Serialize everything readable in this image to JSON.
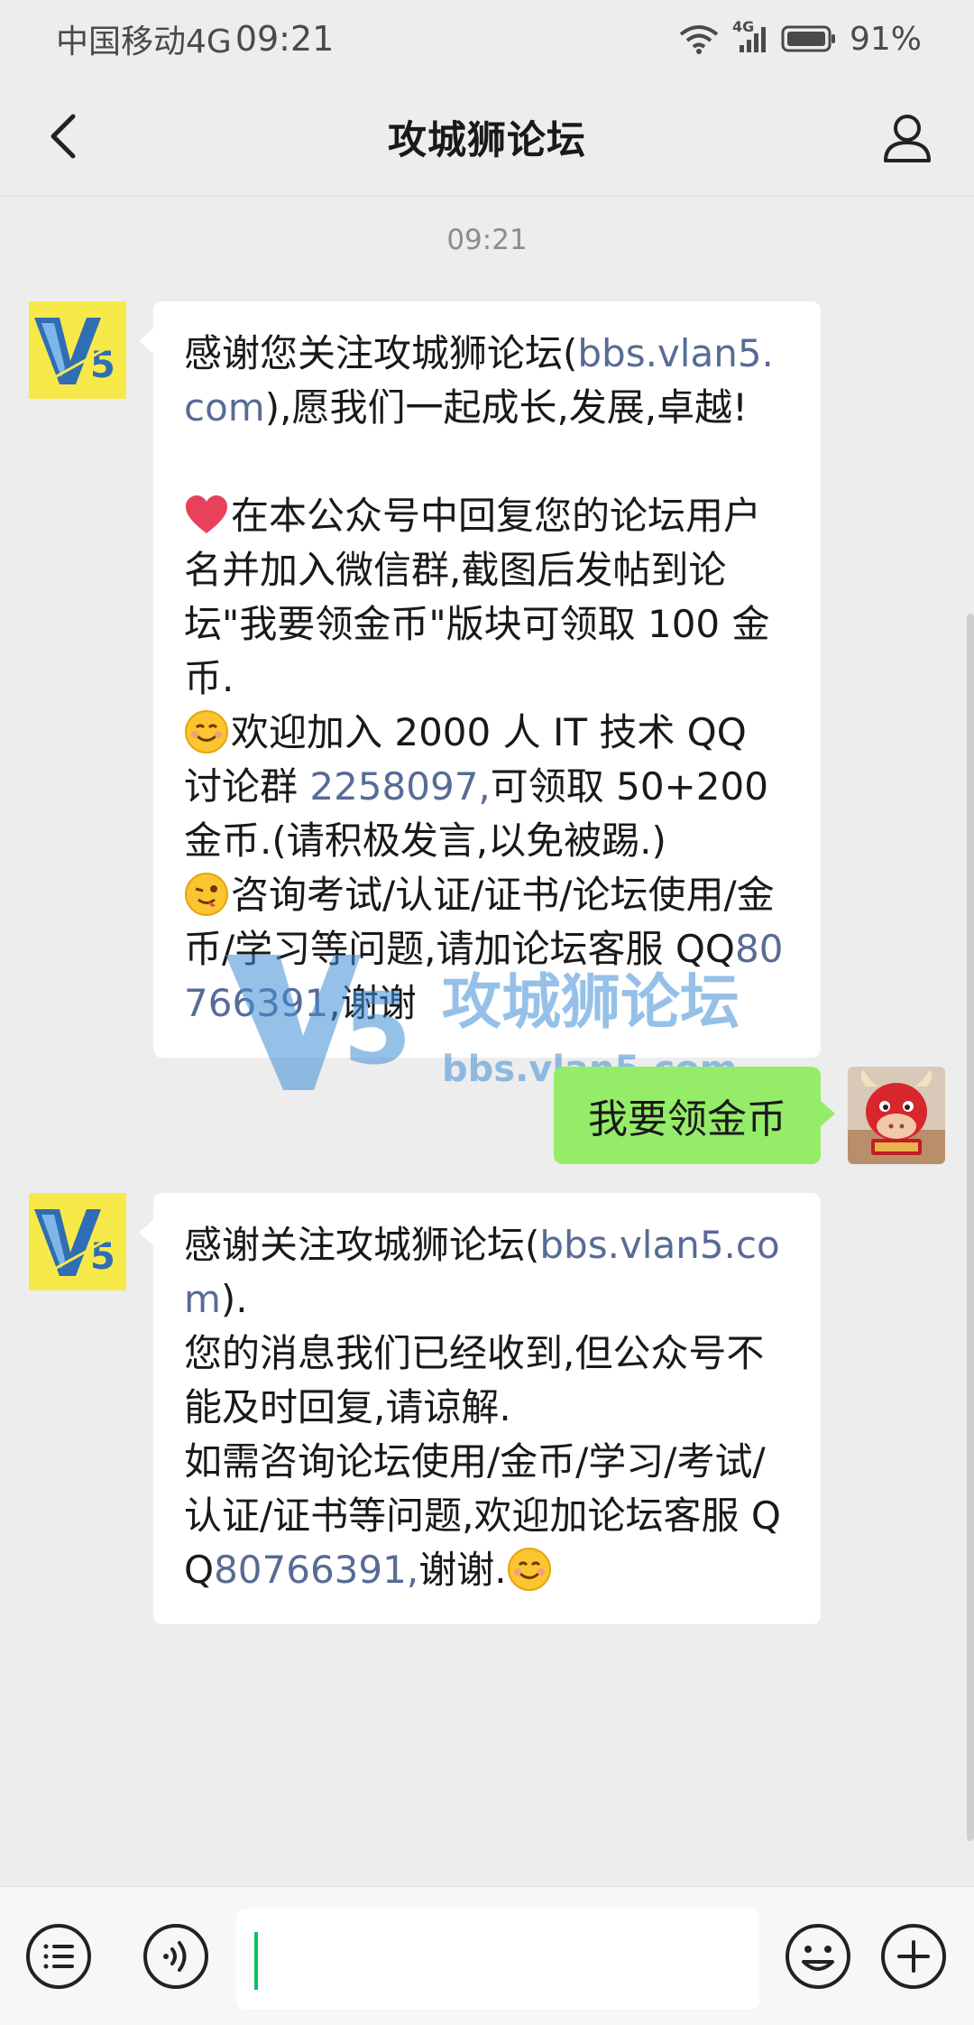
{
  "status_bar": {
    "carrier": "中国移动4G",
    "time": "09:21",
    "network_badge": "4G",
    "battery": "91%"
  },
  "header": {
    "title": "攻城狮论坛",
    "back_icon": "chevron-left-icon",
    "profile_icon": "person-icon"
  },
  "chat": {
    "timestamp": "09:21",
    "messages": [
      {
        "sender": "official-account",
        "segments": {
          "p1_a": "感谢您关注攻城狮论坛(",
          "p1_link": "bbs.vlan5.com",
          "p1_b": "),愿我们一起成长,发展,卓越!",
          "p2": "在本公众号中回复您的论坛用户名并加入微信群,截图后发帖到论坛\"我要领金币\"版块可领取 100 金币.",
          "p3_a": "欢迎加入 2000 人 IT 技术 QQ 讨论群 ",
          "p3_link": "2258097,",
          "p3_b": "可领取 50+200 金币.(请积极发言,以免被踢.)",
          "p4_a": "咨询考试/认证/证书/论坛使用/金币/学习等问题,请加论坛客服 QQ",
          "p4_link": "80766391",
          "p4_b": ",谢谢"
        }
      },
      {
        "sender": "me",
        "text": "我要领金币"
      },
      {
        "sender": "official-account",
        "segments": {
          "l1_a": "感谢关注攻城狮论坛(",
          "l1_link": "bbs.vlan5.com",
          "l1_b": ").",
          "l2": "您的消息我们已经收到,但公众号不能及时回复,请谅解.",
          "l3_a": "如需咨询论坛使用/金币/学习/考试/认证/证书等问题,欢迎加论坛客服 QQ",
          "l3_link": "80766391,",
          "l3_b": "谢谢."
        }
      }
    ]
  },
  "watermark": {
    "logo": "V5",
    "name": "攻城狮论坛",
    "url": "bbs.vlan5.com"
  },
  "avatar_logo_text": "V5",
  "input_bar": {
    "value": "",
    "left_icons": [
      "menu-list-icon",
      "voice-icon"
    ],
    "right_icons": [
      "emoji-icon",
      "plus-icon"
    ]
  },
  "colors": {
    "background": "#ededed",
    "bubble_in": "#ffffff",
    "bubble_out": "#95ec69",
    "link": "#576b95",
    "caret": "#07c160"
  }
}
